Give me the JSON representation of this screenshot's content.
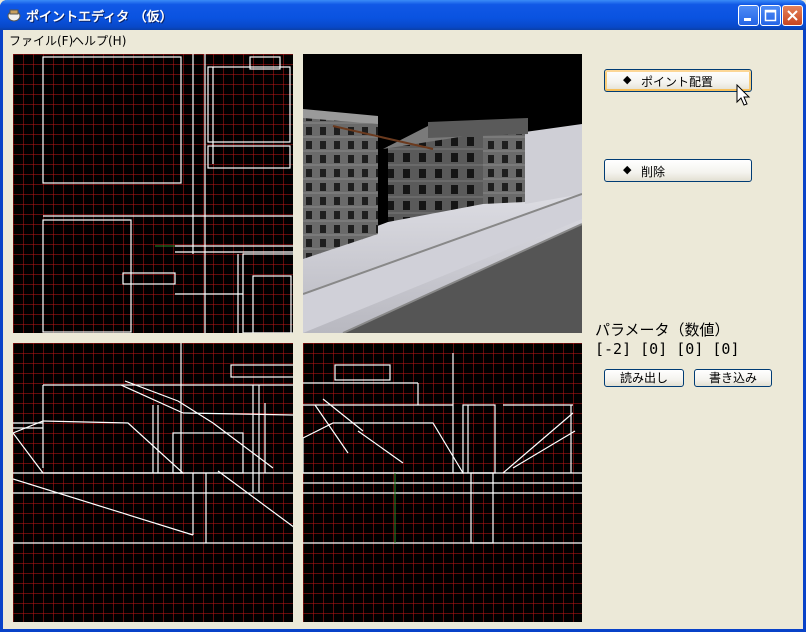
{
  "window": {
    "title": "ポイントエディタ （仮）"
  },
  "menu": {
    "items": [
      {
        "label": "ファイル(F)"
      },
      {
        "label": "ヘルプ(H)"
      }
    ]
  },
  "side": {
    "place_point_label": "ポイント配置",
    "delete_label": "削除",
    "diamond": "◆",
    "param_label": "パラメータ（数値）",
    "param_values": "[-2] [0] [0] [0]",
    "read_label": "読み出し",
    "write_label": "書き込み"
  },
  "colors": {
    "grid": "#c01818",
    "wire": "#ffffff",
    "title_bar": "#0a53e0"
  }
}
